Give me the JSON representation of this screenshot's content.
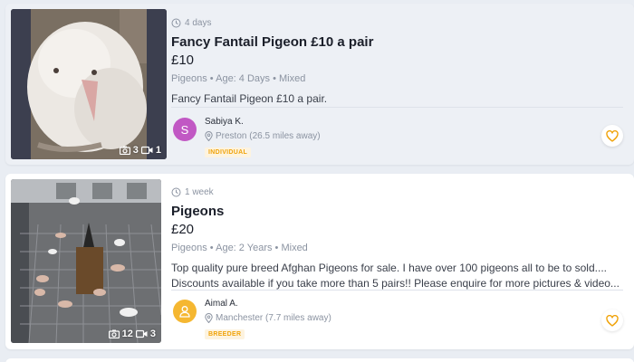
{
  "listings": [
    {
      "posted": "4 days",
      "title": "Fancy Fantail Pigeon £10 a pair",
      "price": "£10",
      "meta": "Pigeons • Age: 4 Days • Mixed",
      "description": "Fancy Fantail Pigeon £10 a pair.",
      "photo_count": "3",
      "video_count": "1",
      "seller": {
        "initial": "S",
        "name": "Sabiya K.",
        "location": "Preston (26.5 miles away)",
        "badge": "INDIVIDUAL",
        "avatar_color": "#c158c4"
      }
    },
    {
      "posted": "1 week",
      "title": "Pigeons",
      "price": "£20",
      "meta": "Pigeons • Age: 2 Years • Mixed",
      "description": "Top quality pure breed Afghan Pigeons for sale. I have over 100 pigeons all to be to sold.... Discounts available if you take more than 5 pairs!! Please enquire for more pictures & video...",
      "photo_count": "12",
      "video_count": "3",
      "seller": {
        "initial": "",
        "name": "Aimal A.",
        "location": "Manchester (7.7 miles away)",
        "badge": "BREEDER",
        "avatar_color": "#f5b731"
      }
    }
  ],
  "colors": {
    "accent": "#f0a30a",
    "page_bg": "#e9edf3",
    "muted_text": "#8b93a1"
  },
  "icons": [
    "clock-icon",
    "camera-icon",
    "video-icon",
    "location-pin-icon",
    "heart-icon",
    "user-icon"
  ]
}
